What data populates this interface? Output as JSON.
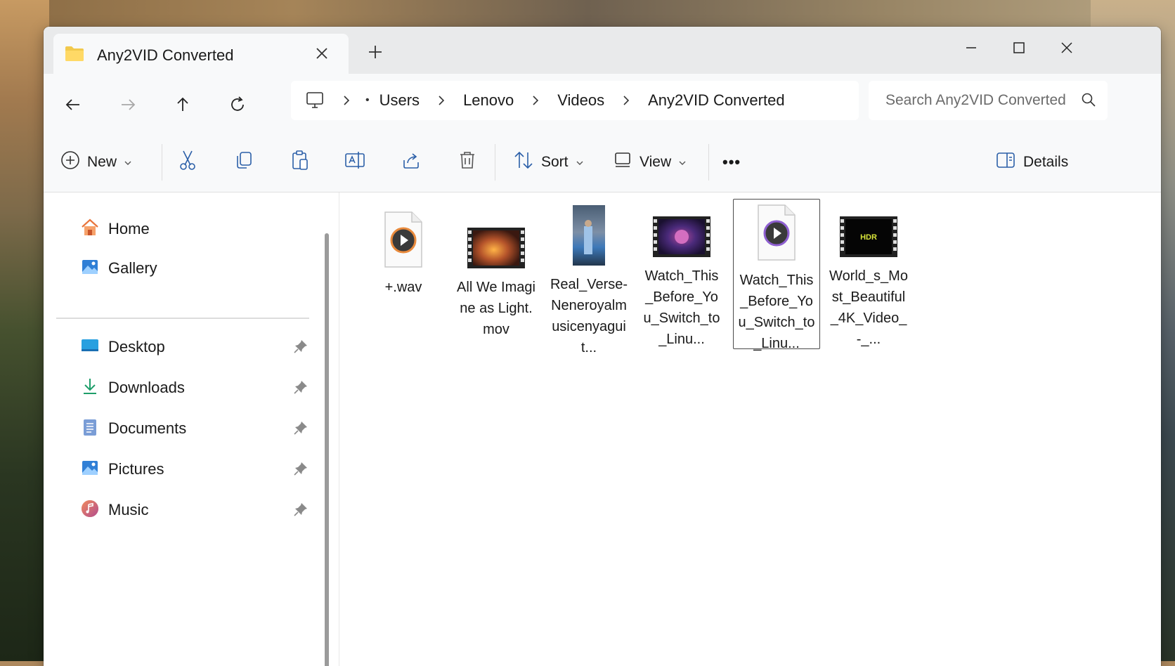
{
  "window": {
    "tab_title": "Any2VID Converted",
    "new_tab_glyph": "+"
  },
  "breadcrumb": {
    "items": [
      "Users",
      "Lenovo",
      "Videos",
      "Any2VID Converted"
    ]
  },
  "search": {
    "placeholder": "Search Any2VID Converted"
  },
  "toolbar": {
    "new_label": "New",
    "sort_label": "Sort",
    "view_label": "View",
    "more_label": "•••",
    "details_label": "Details"
  },
  "sidebar": {
    "top_items": [
      {
        "label": "Home",
        "icon": "home-icon"
      },
      {
        "label": "Gallery",
        "icon": "gallery-icon"
      }
    ],
    "quick_access": [
      {
        "label": "Desktop",
        "icon": "desktop-icon"
      },
      {
        "label": "Downloads",
        "icon": "downloads-icon"
      },
      {
        "label": "Documents",
        "icon": "documents-icon"
      },
      {
        "label": "Pictures",
        "icon": "pictures-icon"
      },
      {
        "label": "Music",
        "icon": "music-icon"
      }
    ]
  },
  "files": [
    {
      "name": "+.wav",
      "type": "audio"
    },
    {
      "name": "All We Imagine as Light.mov",
      "type": "video"
    },
    {
      "name": "Real_Verse-Neneroyalmusicenyaguit...",
      "type": "video-portrait"
    },
    {
      "name": "Watch_This_Before_You_Switch_to_Linu...",
      "type": "video"
    },
    {
      "name": "Watch_This_Before_You_Switch_to_Linu...",
      "type": "media",
      "selected": true
    },
    {
      "name": "World_s_Most_Beautiful_4K_Video_-_...",
      "type": "video",
      "badge": "HDR"
    }
  ],
  "colors": {
    "accent": "#005fb8",
    "folder": "#f2c94c"
  }
}
